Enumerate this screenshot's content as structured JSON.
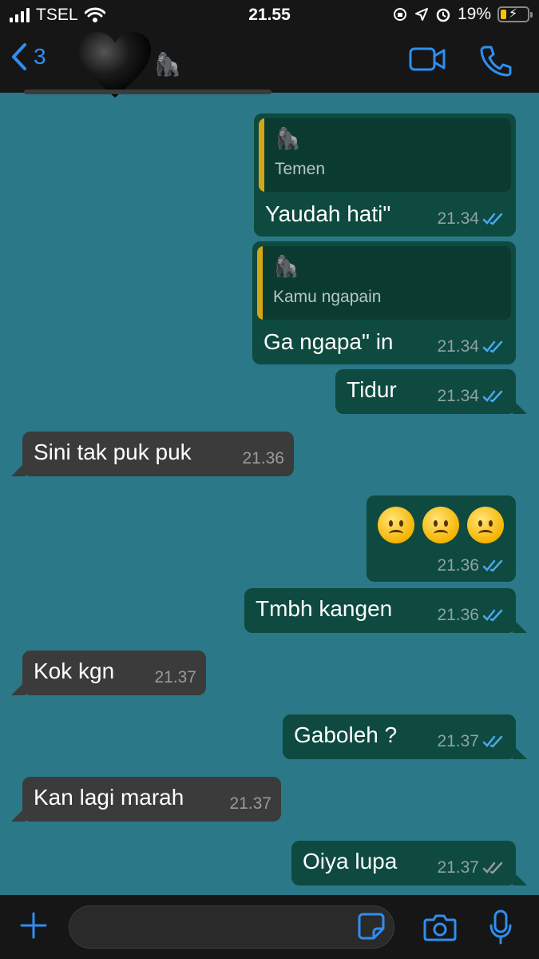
{
  "status": {
    "carrier": "TSEL",
    "time": "21.55",
    "battery": "19%"
  },
  "header": {
    "back_count": "3",
    "contact_emoji": "🦍",
    "accent_color": "#2e8ff0"
  },
  "messages": [
    {
      "from": "me",
      "quote_emoji": "🦍",
      "quote_text": "Temen",
      "text": "Yaudah hati\"",
      "time": "21.34",
      "status": "read"
    },
    {
      "from": "me",
      "quote_emoji": "🦍",
      "quote_text": "Kamu ngapain",
      "text": "Ga ngapa\" in",
      "time": "21.34",
      "status": "read"
    },
    {
      "from": "me",
      "text": "Tidur",
      "time": "21.34",
      "status": "read"
    },
    {
      "from": "them",
      "text": "Sini tak puk puk",
      "time": "21.36"
    },
    {
      "from": "me",
      "emoji": "frowning-face x3",
      "time": "21.36",
      "status": "read"
    },
    {
      "from": "me",
      "text": "Tmbh kangen",
      "time": "21.36",
      "status": "read"
    },
    {
      "from": "them",
      "text": "Kok kgn",
      "time": "21.37"
    },
    {
      "from": "me",
      "text": "Gaboleh ?",
      "time": "21.37",
      "status": "read"
    },
    {
      "from": "them",
      "text": "Kan lagi marah",
      "time": "21.37"
    },
    {
      "from": "me",
      "text": "Oiya lupa",
      "time": "21.37",
      "status": "delivered"
    }
  ],
  "colors": {
    "chat_background": "#2b7888",
    "outgoing_bubble": "#0e4a3f",
    "incoming_bubble": "#3b3b3b",
    "read_tick": "#4aa8f0",
    "delivered_tick": "#9a9a9a",
    "quote_bar": "#d4a517"
  },
  "composer": {
    "icons": [
      "plus-icon",
      "sticker-icon",
      "camera-icon",
      "microphone-icon"
    ]
  }
}
